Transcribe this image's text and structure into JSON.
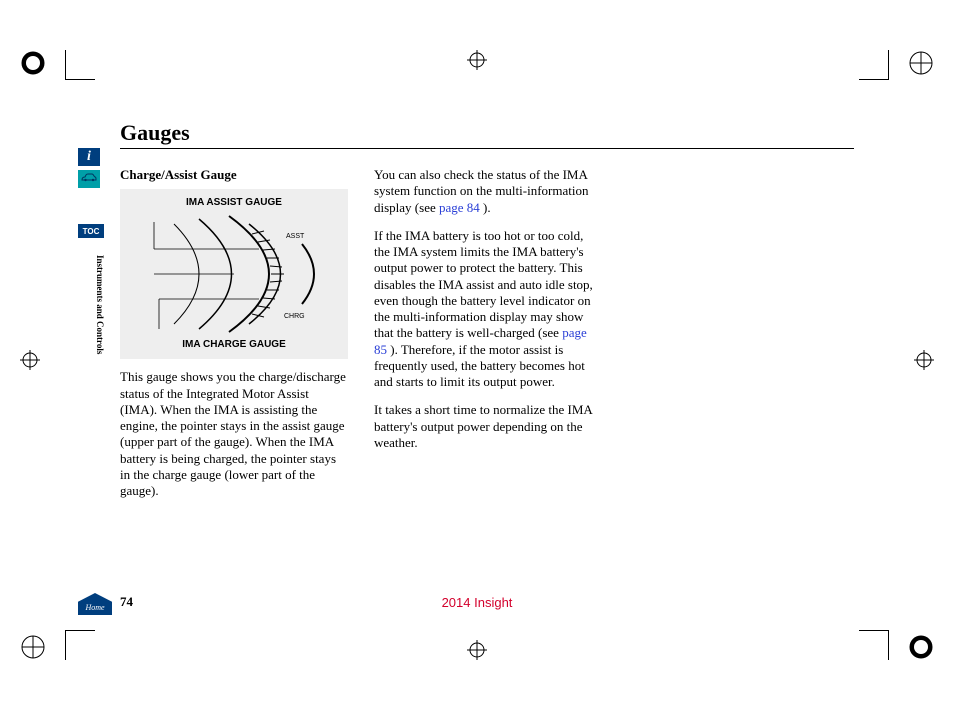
{
  "page": {
    "title": "Gauges",
    "number": "74",
    "model_year": "2014 Insight",
    "section_label": "Instruments and Controls"
  },
  "sidebar": {
    "info_label": "i",
    "toc_label": "TOC",
    "home_label": "Home"
  },
  "column1": {
    "subheading": "Charge/Assist Gauge",
    "diagram": {
      "top_label": "IMA ASSIST GAUGE",
      "bottom_label": "IMA CHARGE GAUGE",
      "asst_text": "ASST",
      "chrg_text": "CHRG"
    },
    "para1": "This gauge shows you the charge/discharge status of the Integrated Motor Assist (IMA). When the IMA is assisting the engine, the pointer stays in the assist gauge (upper part of the gauge). When the IMA battery is being charged, the pointer stays in the charge gauge (lower part of the gauge)."
  },
  "column2": {
    "para1_a": "You can also check the status of the IMA system function on the multi-information display (see ",
    "para1_link": "page  84",
    "para1_b": " ).",
    "para2_a": "If the IMA battery is too hot or too cold, the IMA system limits the IMA battery's output power to protect the battery. This disables the IMA assist and auto idle stop, even though the battery level indicator on the multi-information display may show that the battery is well-charged (see ",
    "para2_link": "page 85",
    "para2_b": " ). Therefore, if the motor assist  is frequently used, the battery  becomes hot and starts to limit  its  output power.",
    "para3": "It takes a short time to normalize the IMA battery's output power depending on the weather."
  }
}
